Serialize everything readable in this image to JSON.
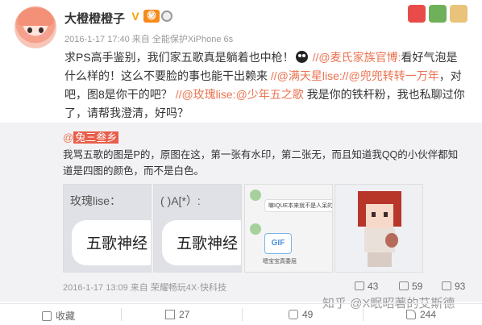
{
  "post": {
    "username": "大橙橙橙子",
    "badge_v": "V",
    "badge_vip": "㊙",
    "time": "2016-1-17 17:40",
    "source_prefix": "来自",
    "source": "全能保护XiPhone 6s",
    "text_1": "求PS高手鉴别，我们家五歌真是躺着也中枪！",
    "text_2": "//@麦氏家族官博:",
    "text_3": "看好气泡是什么样的！这么不要脸的事也能干出赖来",
    "text_4": "//@满天星lise:",
    "text_5": "//@兜兜转转一万年",
    "text_6": "，对吧，图8是你干的吧？",
    "text_7": "//@玫瑰lise:",
    "text_8": "@少年五之歌",
    "text_9": "我是你的铁杆粉，我也私聊过你了，请帮我澄清，好吗？"
  },
  "repost": {
    "at_prefix": "@",
    "username": "兔三叁乡",
    "text": "我骂五歌的图是P的，原图在这，第一张有水印，第二张无，而且知道我QQ的小伙伴都知道是四图的颜色，而不是白色。",
    "images": [
      {
        "top_label": "玫瑰lise：",
        "bubble_text": "五歌神经"
      },
      {
        "top_label": "( )A[*）:",
        "bubble_text": "五歌神经"
      }
    ],
    "chat": {
      "message": "嘛IQUE本来就不是人呆的",
      "gif_label": "GIF",
      "gif_caption": "嗯宝宝真委屈"
    },
    "time": "2016-1-17 13:09",
    "source_prefix": "来自",
    "source": "荣耀畅玩4X·快科技",
    "reposts": "43",
    "comments": "59",
    "likes": "93"
  },
  "actions": {
    "favorite": "收藏",
    "repost": "27",
    "comment": "49",
    "like": "244"
  },
  "watermark": "知乎 @X眠昭著的艾斯德"
}
